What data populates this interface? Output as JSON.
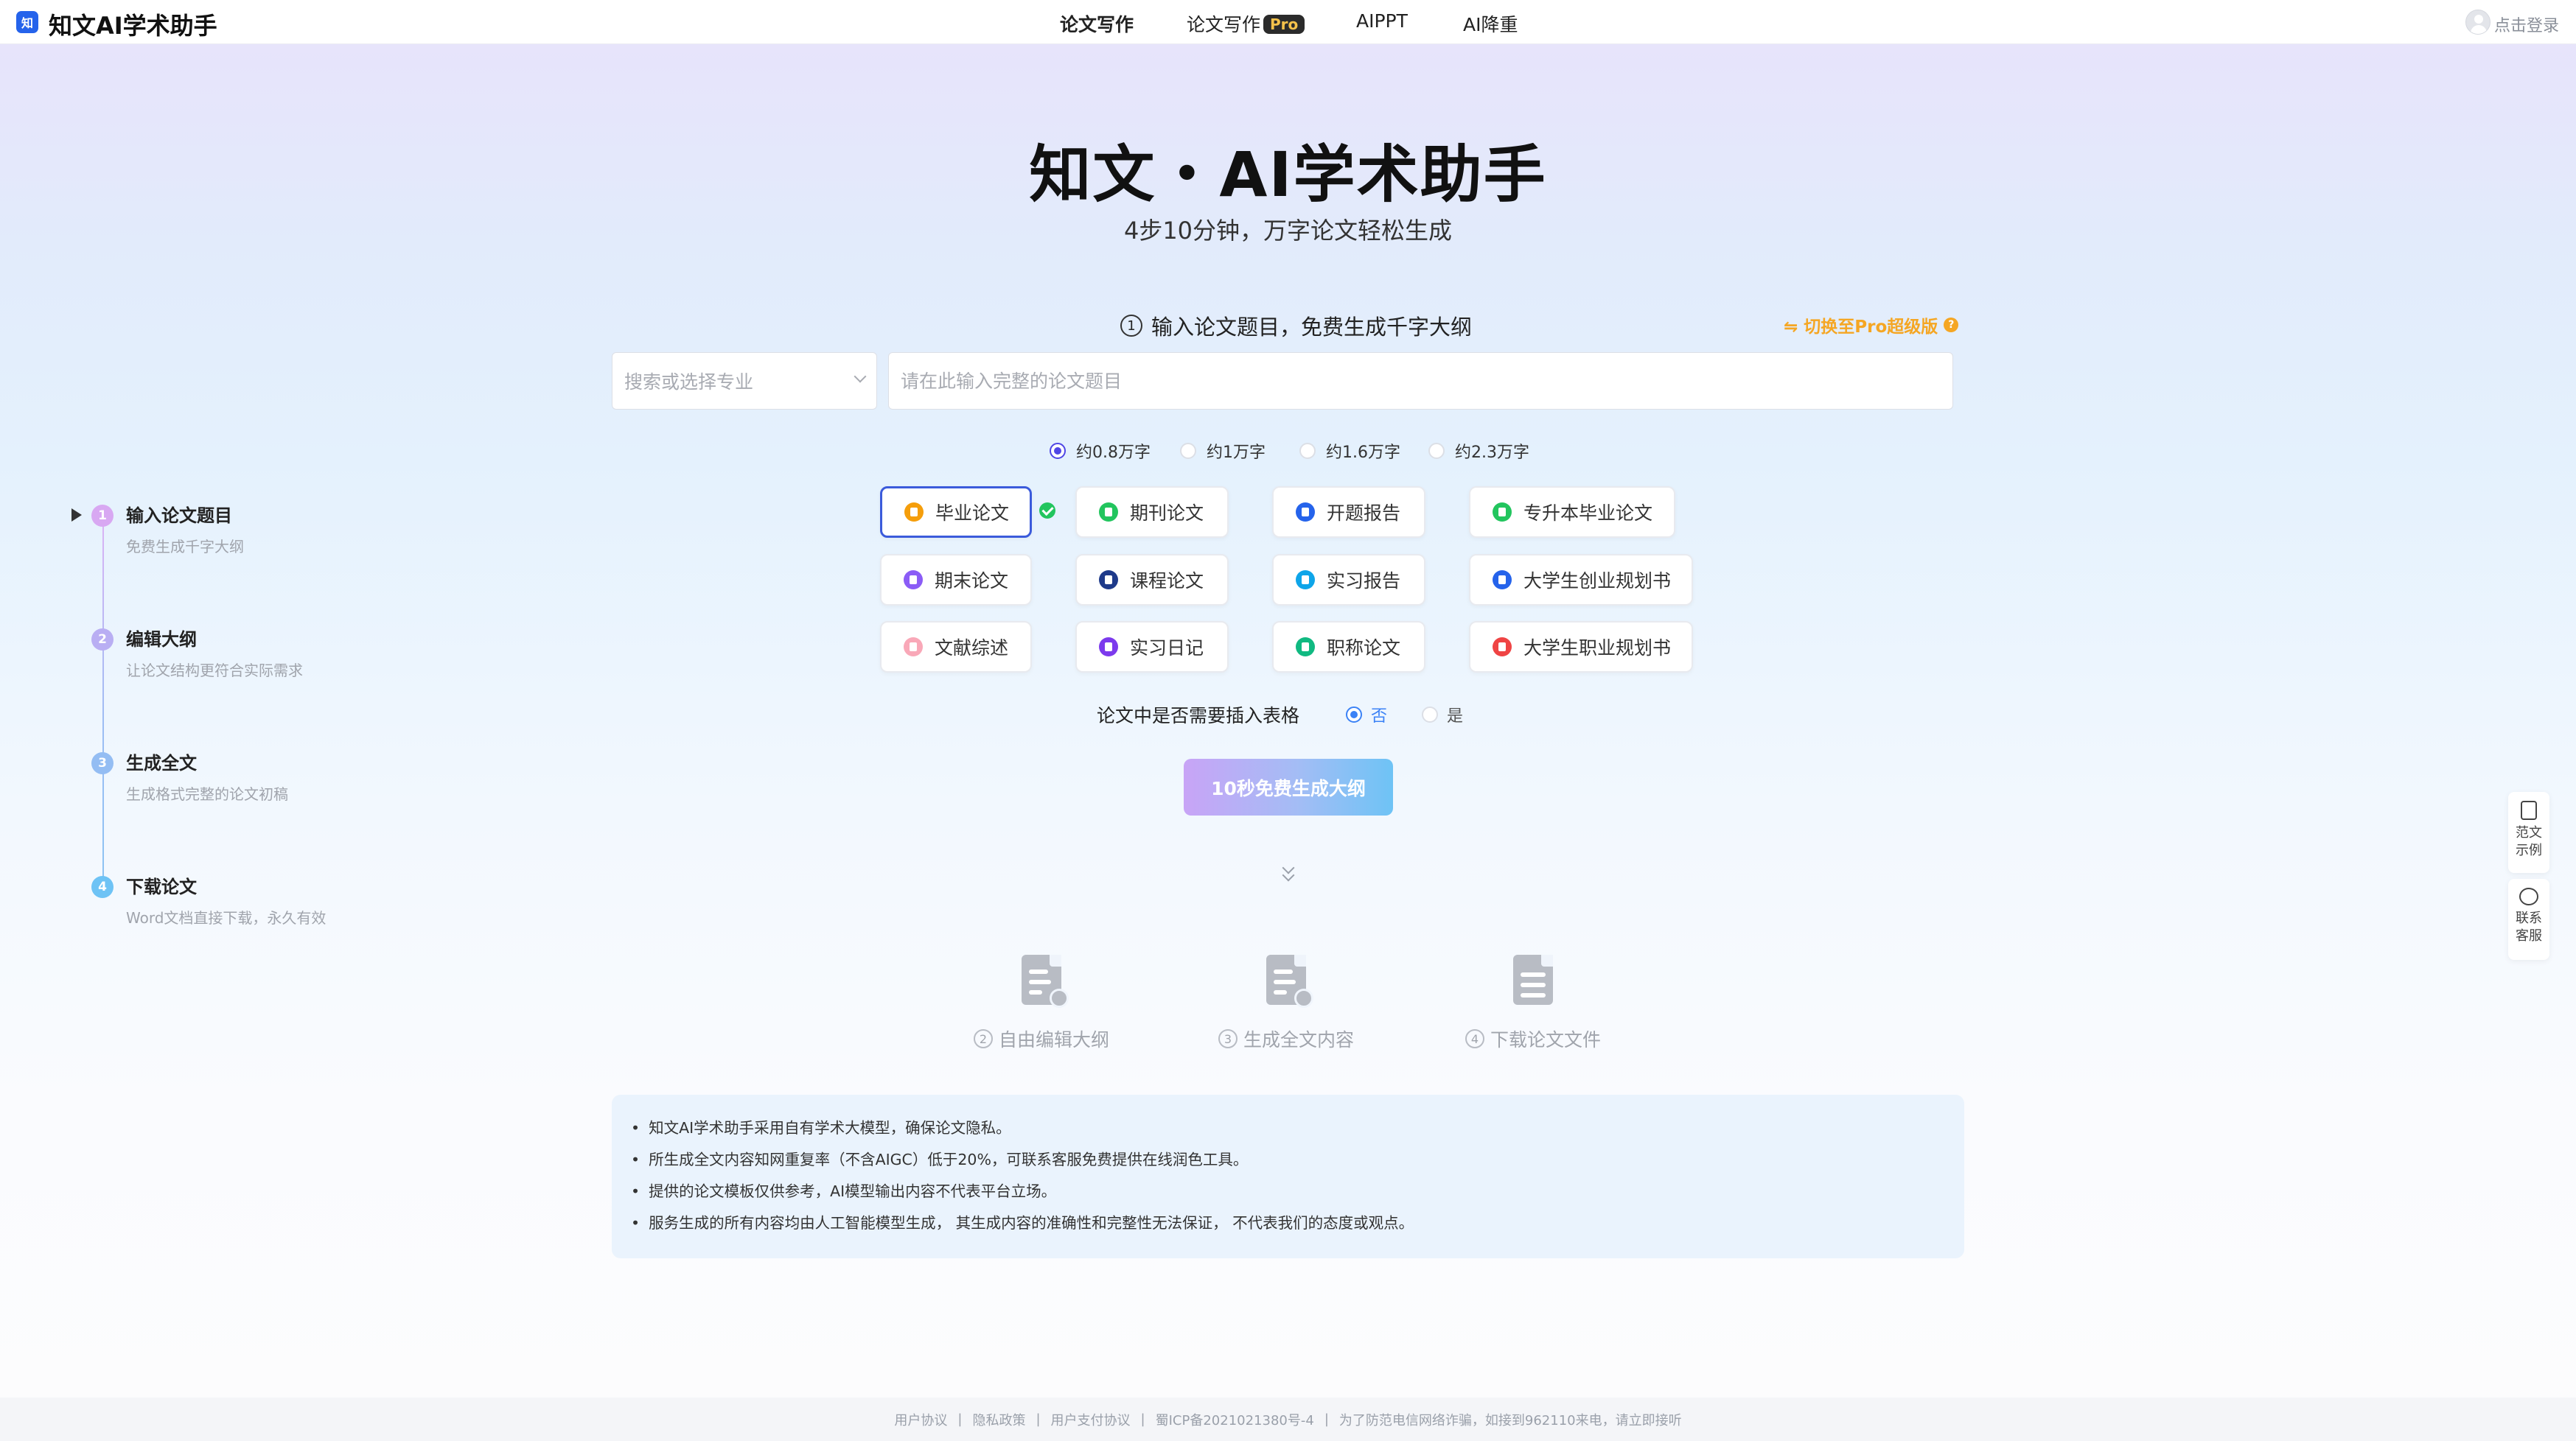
{
  "header": {
    "logo_glyph": "知",
    "app_name": "知文AI学术助手",
    "nav": [
      {
        "label": "论文写作",
        "active": true
      },
      {
        "label": "论文写作",
        "badge": "Pro"
      },
      {
        "label": "AIPPT"
      },
      {
        "label": "AI降重"
      }
    ],
    "login": "点击登录"
  },
  "hero": {
    "title": "知文・AI学术助手",
    "subtitle": "4步10分钟，万字论文轻松生成"
  },
  "form": {
    "step_num": "1",
    "step_label": "输入论文题目，免费生成千字大纲",
    "pro_switch": "⇋ 切换至Pro超级版",
    "pro_help": "?",
    "major_placeholder": "搜索或选择专业",
    "title_placeholder": "请在此输入完整的论文题目",
    "length_options": [
      {
        "label": "约0.8万字",
        "checked": true
      },
      {
        "label": "约1万字",
        "checked": false
      },
      {
        "label": "约1.6万字",
        "checked": false
      },
      {
        "label": "约2.3万字",
        "checked": false
      }
    ],
    "paper_types": [
      {
        "label": "毕业论文",
        "color": "#f59e0b",
        "selected": true
      },
      {
        "label": "期刊论文",
        "color": "#22c55e"
      },
      {
        "label": "开题报告",
        "color": "#2563eb"
      },
      {
        "label": "专升本毕业论文",
        "color": "#22c55e"
      },
      {
        "label": "期末论文",
        "color": "#8b5cf6"
      },
      {
        "label": "课程论文",
        "color": "#1e3a8a"
      },
      {
        "label": "实习报告",
        "color": "#0ea5e9"
      },
      {
        "label": "大学生创业规划书",
        "color": "#2563eb"
      },
      {
        "label": "文献综述",
        "color": "#f9a8b8"
      },
      {
        "label": "实习日记",
        "color": "#7c3aed"
      },
      {
        "label": "职称论文",
        "color": "#10b981"
      },
      {
        "label": "大学生职业规划书",
        "color": "#ef4444"
      }
    ],
    "table_question": "论文中是否需要插入表格",
    "table_options": [
      {
        "label": "否",
        "checked": true
      },
      {
        "label": "是",
        "checked": false
      }
    ],
    "generate_button": "10秒免费生成大纲"
  },
  "next_steps": [
    {
      "num": "2",
      "label": "自由编辑大纲",
      "icon": "edit-doc-icon"
    },
    {
      "num": "3",
      "label": "生成全文内容",
      "icon": "clock-doc-icon"
    },
    {
      "num": "4",
      "label": "下载论文文件",
      "icon": "file-doc-icon"
    }
  ],
  "notices": [
    "知文AI学术助手采用自有学术大模型，确保论文隐私。",
    "所生成全文内容知网重复率（不含AIGC）低于20%，可联系客服免费提供在线润色工具。",
    "提供的论文模板仅供参考，AI模型输出内容不代表平台立场。",
    "服务生成的所有内容均由人工智能模型生成， 其生成内容的准确性和完整性无法保证， 不代表我们的态度或观点。"
  ],
  "side_steps": [
    {
      "num": "1",
      "title": "输入论文题目",
      "desc": "免费生成千字大纲",
      "color": "#d8a8f2"
    },
    {
      "num": "2",
      "title": "编辑大纲",
      "desc": "让论文结构更符合实际需求",
      "color": "#b9aef3"
    },
    {
      "num": "3",
      "title": "生成全文",
      "desc": "生成格式完整的论文初稿",
      "color": "#94bdf3"
    },
    {
      "num": "4",
      "title": "下载论文",
      "desc": "Word文档直接下载，永久有效",
      "color": "#6ec3f5"
    }
  ],
  "float_panel": [
    {
      "label": "范文\n示例",
      "icon": "document-icon"
    },
    {
      "label": "联系\n客服",
      "icon": "chat-icon"
    }
  ],
  "footer": {
    "links": [
      "用户协议",
      "隐私政策",
      "用户支付协议",
      "蜀ICP备2021021380号-4",
      "为了防范电信网络诈骗，如接到962110来电，请立即接听"
    ],
    "separator": "|"
  }
}
